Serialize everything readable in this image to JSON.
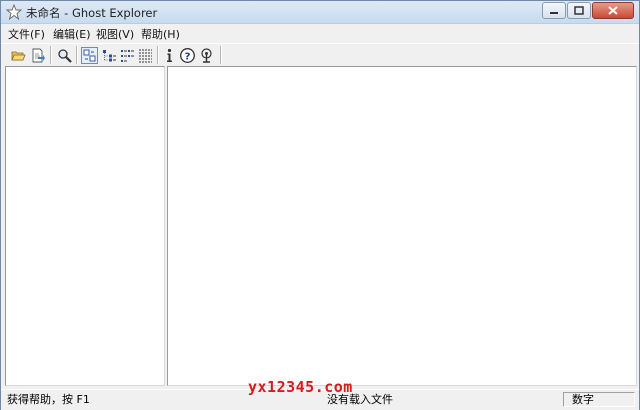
{
  "window": {
    "title": "未命名 - Ghost Explorer"
  },
  "menu": [
    {
      "label": "文件(F)"
    },
    {
      "label": "编辑(E)"
    },
    {
      "label": "视图(V)"
    },
    {
      "label": "帮助(H)"
    }
  ],
  "toolbar": {
    "buttons": [
      {
        "name": "open-icon"
      },
      {
        "name": "extract-icon"
      },
      {
        "name": "find-icon"
      },
      {
        "name": "large-icons-view-icon",
        "active": true
      },
      {
        "name": "tree-view-icon"
      },
      {
        "name": "list-view-icon"
      },
      {
        "name": "details-view-icon"
      },
      {
        "name": "info-icon"
      },
      {
        "name": "help-icon"
      },
      {
        "name": "wizard-icon"
      }
    ]
  },
  "status": {
    "help_text": "获得帮助，按 F1",
    "file_text": "没有载入文件",
    "numlock_text": "数字"
  },
  "watermark": "yx12345.com"
}
